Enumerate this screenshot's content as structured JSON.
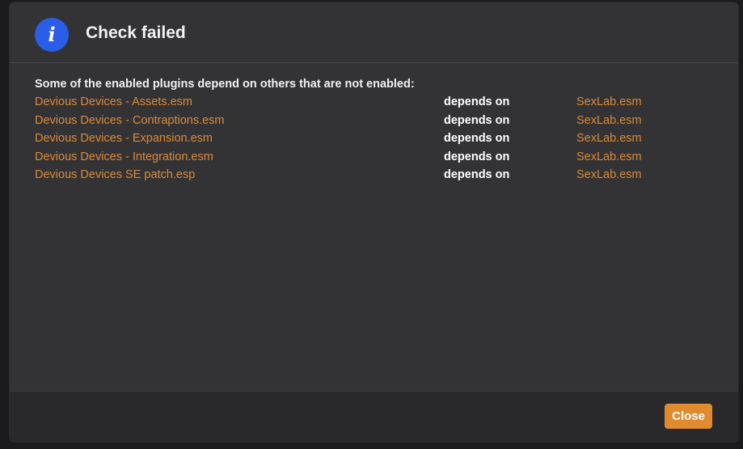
{
  "dialog": {
    "title": "Check failed",
    "icon": "info-icon",
    "intro": "Some of the enabled plugins depend on others that are not enabled:",
    "rows": [
      {
        "plugin": "Devious Devices - Assets.esm",
        "relation": "depends on",
        "master": "SexLab.esm"
      },
      {
        "plugin": "Devious Devices - Contraptions.esm",
        "relation": "depends on",
        "master": "SexLab.esm"
      },
      {
        "plugin": "Devious Devices - Expansion.esm",
        "relation": "depends on",
        "master": "SexLab.esm"
      },
      {
        "plugin": "Devious Devices - Integration.esm",
        "relation": "depends on",
        "master": "SexLab.esm"
      },
      {
        "plugin": "Devious Devices SE patch.esp",
        "relation": "depends on",
        "master": "SexLab.esm"
      }
    ],
    "close_label": "Close"
  },
  "colors": {
    "accent": "#e08b2f",
    "link": "#dc8a35",
    "icon_bg": "#2a5ee8",
    "dialog_bg": "#333336",
    "footer_bg": "#29292c"
  }
}
